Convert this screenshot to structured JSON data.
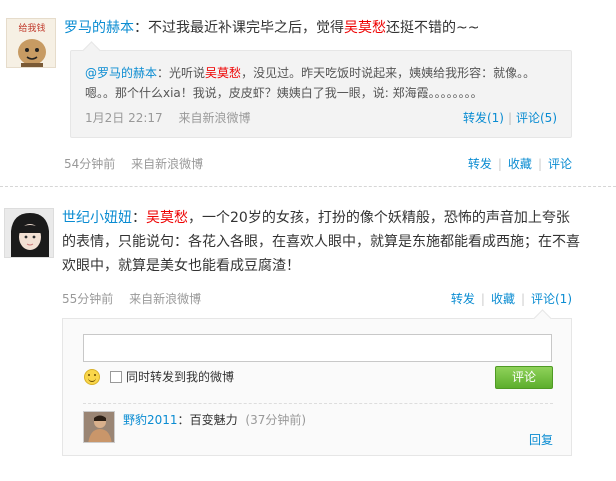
{
  "post1": {
    "author": "罗马的赫本",
    "colon": "：",
    "text_a": "不过我最近补课完毕之后，觉得",
    "highlight": "吴莫愁",
    "text_b": "还挺不错的~~",
    "retweet": {
      "author": "@罗马的赫本",
      "colon": "：",
      "text_a": "光听说",
      "highlight": "吴莫愁",
      "text_b": "，没见过。昨天吃饭时说起来，姨姨给我形容：就像。。嗯。。那个什么xia！我说，皮皮虾？姨姨白了我一眼，说: 郑海霞。。。。。。。。",
      "time": "1月2日 22:17",
      "source": "来自新浪微博",
      "repost": "转发(1)",
      "comment": "评论(5)",
      "separator": "|"
    },
    "time": "54分钟前",
    "source": "来自新浪微博",
    "actions": [
      "转发",
      "收藏",
      "评论"
    ],
    "separator": "|"
  },
  "post2": {
    "author": "世纪小妞妞",
    "colon": "：",
    "highlight": "吴莫愁",
    "text": "，一个20岁的女孩，打扮的像个妖精般，恐怖的声音加上夸张的表情，只能说句：各花入各眼，在喜欢人眼中，就算是东施都能看成西施；在不喜欢眼中，就算是美女也能看成豆腐渣！",
    "time": "55分钟前",
    "source": "来自新浪微博",
    "actions": [
      "转发",
      "收藏",
      "评论(1)"
    ],
    "separator": "|",
    "comment_form": {
      "input_value": "",
      "checkbox_label": "同时转发到我的微博",
      "submit_label": "评论",
      "icon": "smiley-icon"
    },
    "reply": {
      "author": "野豹2011",
      "colon": "：",
      "text": "百变魅力",
      "time": "(37分钟前)",
      "reply_label": "回复"
    }
  },
  "colors": {
    "link": "#0a8cd2",
    "highlight": "#e00000",
    "submit": "#5cae2c"
  }
}
